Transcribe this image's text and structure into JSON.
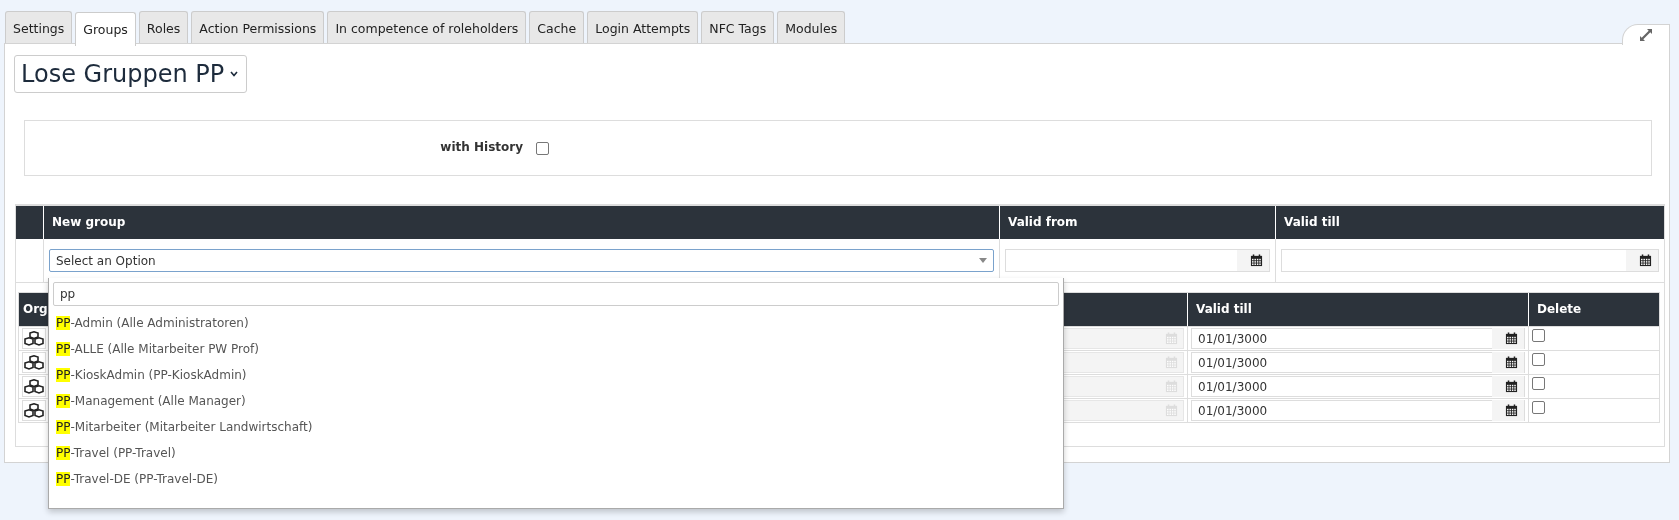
{
  "tabs": [
    {
      "label": "Settings",
      "selected": false
    },
    {
      "label": "Groups",
      "selected": true
    },
    {
      "label": "Roles",
      "selected": false
    },
    {
      "label": "Action Permissions",
      "selected": false
    },
    {
      "label": "In competence of roleholders",
      "selected": false
    },
    {
      "label": "Cache",
      "selected": false
    },
    {
      "label": "Login Attempts",
      "selected": false
    },
    {
      "label": "NFC Tags",
      "selected": false
    },
    {
      "label": "Modules",
      "selected": false
    }
  ],
  "group_select": {
    "value": "Lose Gruppen PP"
  },
  "history": {
    "label": "with History",
    "checked": false
  },
  "new_group_table": {
    "columns": [
      "New group",
      "Valid from",
      "Valid till"
    ],
    "group_field": {
      "placeholder": "Select an Option"
    }
  },
  "dropdown": {
    "search_value": "pp",
    "options": [
      {
        "match": "PP",
        "rest": "-Admin (Alle Administratoren)"
      },
      {
        "match": "PP",
        "rest": "-ALLE (Alle Mitarbeiter PW Prof)"
      },
      {
        "match": "PP",
        "rest": "-KioskAdmin (PP-KioskAdmin)"
      },
      {
        "match": "PP",
        "rest": "-Management (Alle Manager)"
      },
      {
        "match": "PP",
        "rest": "-Mitarbeiter (Mitarbeiter Landwirtschaft)"
      },
      {
        "match": "PP",
        "rest": "-Travel (PP-Travel)"
      },
      {
        "match": "PP",
        "rest": "-Travel-DE (PP-Travel-DE)"
      }
    ]
  },
  "groups_table": {
    "columns": [
      "Org",
      "Valid till",
      "Delete"
    ],
    "rows": [
      {
        "valid_till": "01/01/3000",
        "delete": false
      },
      {
        "valid_till": "01/01/3000",
        "delete": false
      },
      {
        "valid_till": "01/01/3000",
        "delete": false
      },
      {
        "valid_till": "01/01/3000",
        "delete": false
      }
    ]
  }
}
